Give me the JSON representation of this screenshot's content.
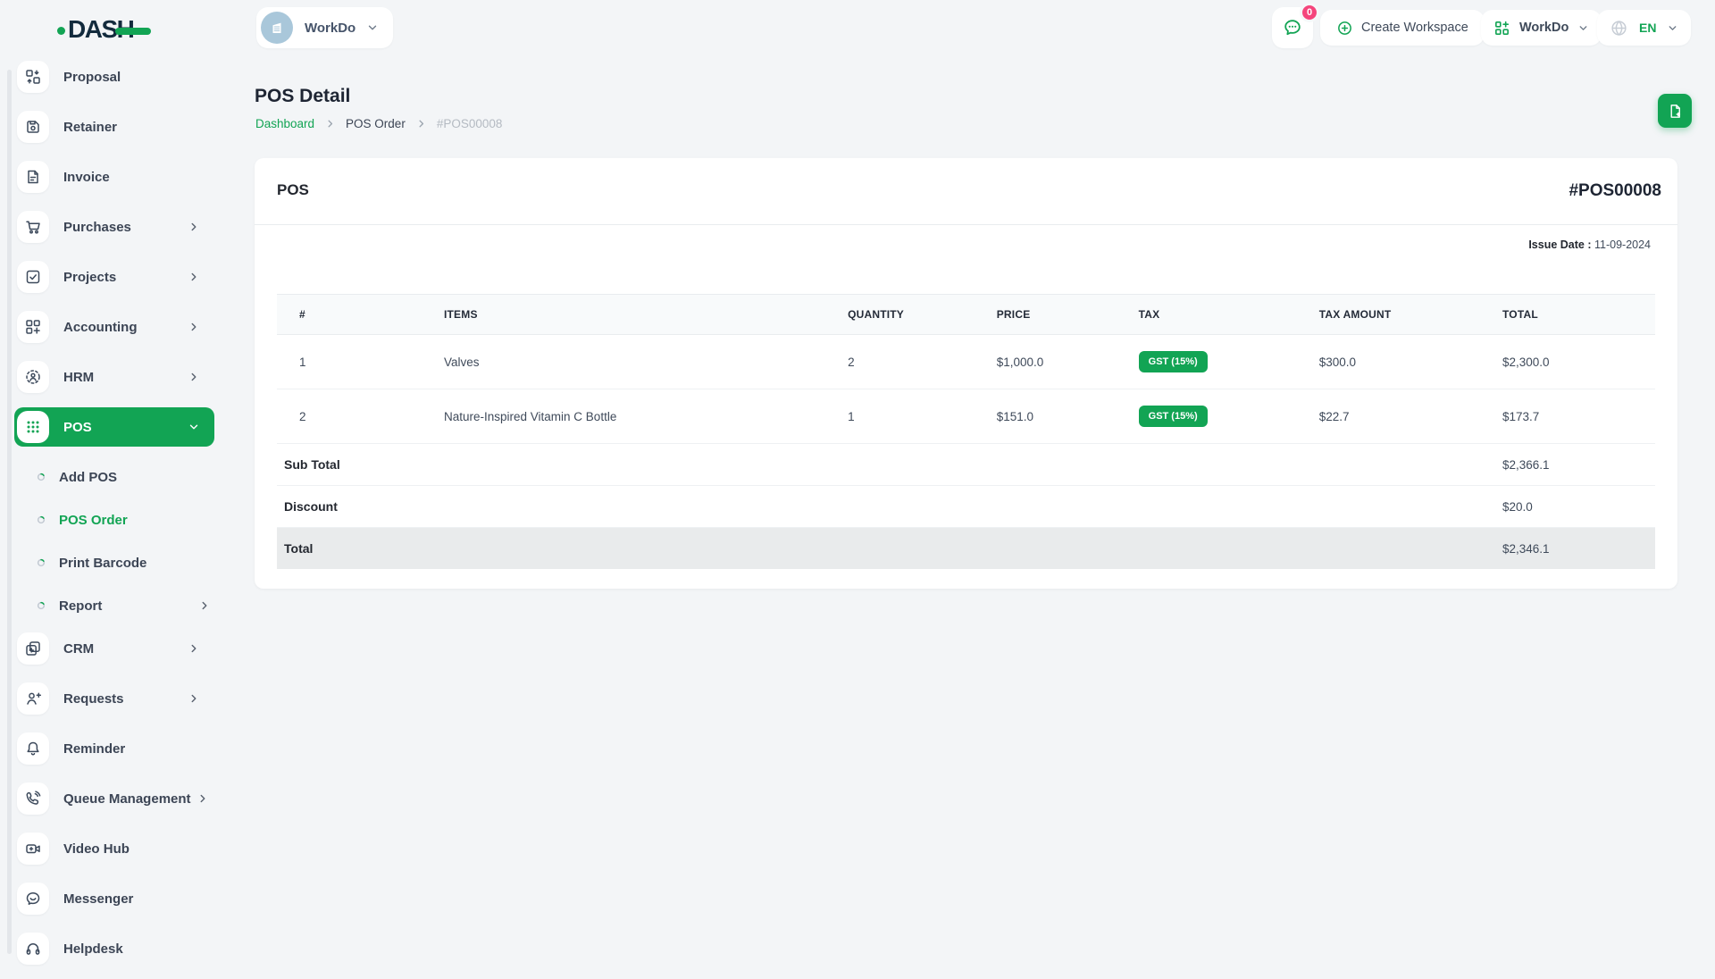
{
  "brand": {
    "logo_text": "DASH"
  },
  "header": {
    "workspace_selector": {
      "label": "WorkDo"
    },
    "messages_badge": "0",
    "create_workspace_label": "Create Workspace",
    "workspace_menu_label": "WorkDo",
    "language": "EN"
  },
  "sidebar": {
    "items": [
      {
        "label": "Proposal",
        "icon": "proposal-icon"
      },
      {
        "label": "Retainer",
        "icon": "retainer-icon"
      },
      {
        "label": "Invoice",
        "icon": "invoice-icon"
      },
      {
        "label": "Purchases",
        "icon": "purchases-icon",
        "chevron": true
      },
      {
        "label": "Projects",
        "icon": "projects-icon",
        "chevron": true
      },
      {
        "label": "Accounting",
        "icon": "accounting-icon",
        "chevron": true
      },
      {
        "label": "HRM",
        "icon": "hrm-icon",
        "chevron": true
      },
      {
        "label": "POS",
        "icon": "pos-icon",
        "active": true,
        "expanded": true
      },
      {
        "label": "Add POS",
        "sub": true
      },
      {
        "label": "POS Order",
        "sub": true,
        "active": true
      },
      {
        "label": "Print Barcode",
        "sub": true
      },
      {
        "label": "Report",
        "sub": true,
        "chevron": true
      },
      {
        "label": "CRM",
        "icon": "crm-icon",
        "chevron": true
      },
      {
        "label": "Requests",
        "icon": "requests-icon",
        "chevron": true
      },
      {
        "label": "Reminder",
        "icon": "reminder-icon"
      },
      {
        "label": "Queue Management",
        "icon": "queue-management-icon",
        "chevron": true
      },
      {
        "label": "Video Hub",
        "icon": "video-hub-icon"
      },
      {
        "label": "Messenger",
        "icon": "messenger-icon"
      },
      {
        "label": "Helpdesk",
        "icon": "helpdesk-icon"
      }
    ]
  },
  "page": {
    "title": "POS Detail",
    "breadcrumb": [
      "Dashboard",
      "POS Order",
      "#POS00008"
    ]
  },
  "pos_card": {
    "title": "POS",
    "number": "#POS00008",
    "issue_date_label": "Issue Date :",
    "issue_date_value": "11-09-2024",
    "table": {
      "columns": [
        "#",
        "ITEMS",
        "QUANTITY",
        "PRICE",
        "TAX",
        "TAX AMOUNT",
        "TOTAL"
      ],
      "rows": [
        {
          "index": "1",
          "item": "Valves",
          "quantity": "2",
          "price": "$1,000.0",
          "tax": "GST (15%)",
          "tax_amount": "$300.0",
          "total": "$2,300.0"
        },
        {
          "index": "2",
          "item": "Nature-Inspired Vitamin C Bottle",
          "quantity": "1",
          "price": "$151.0",
          "tax": "GST (15%)",
          "tax_amount": "$22.7",
          "total": "$173.7"
        }
      ],
      "summary": [
        {
          "label": "Sub Total",
          "value": "$2,366.1"
        },
        {
          "label": "Discount",
          "value": "$20.0"
        },
        {
          "label": "Total",
          "value": "$2,346.1",
          "highlight": true
        }
      ]
    }
  },
  "colors": {
    "primary": "#12a454",
    "navy": "#132b3d",
    "badge_pink": "#f5457c"
  }
}
